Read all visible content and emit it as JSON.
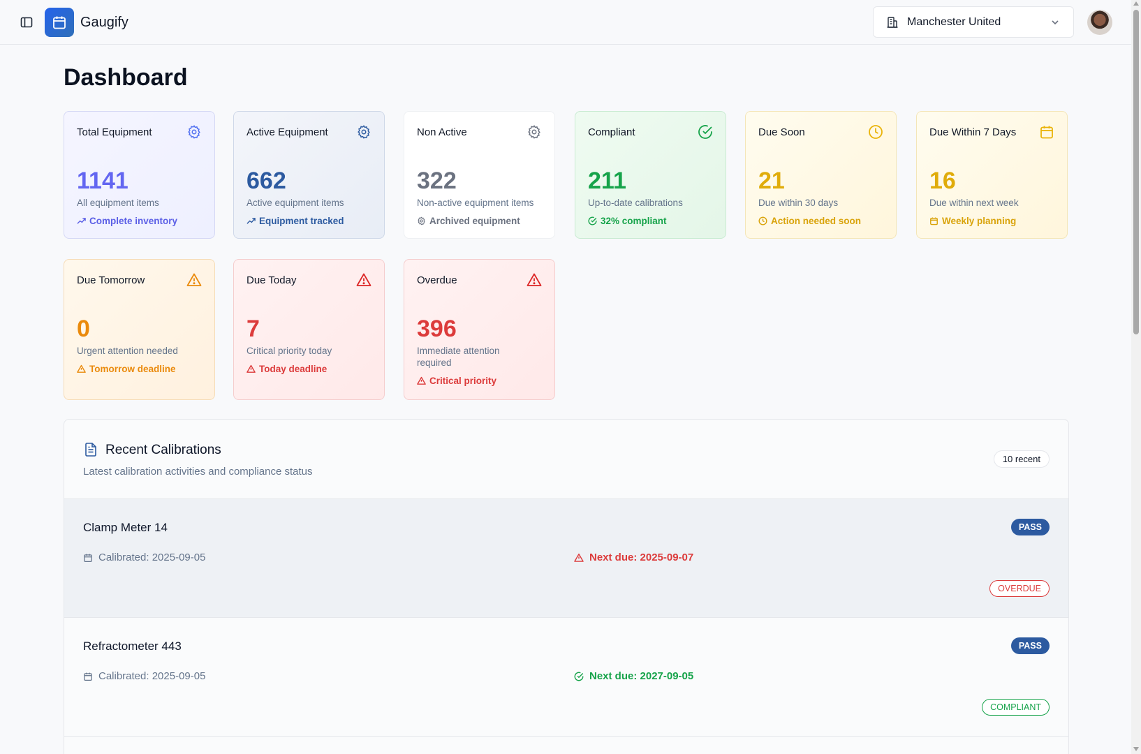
{
  "app": {
    "name": "Gaugify"
  },
  "header": {
    "org_name": "Manchester United"
  },
  "page": {
    "title": "Dashboard"
  },
  "colors": {
    "blue": "#6366f1",
    "navy": "#2c5aa0",
    "gray": "#6b7280",
    "green": "#16a34a",
    "yellow": "#eab308",
    "orange": "#ea8a0c",
    "red": "#dc2626"
  },
  "cards": [
    {
      "title": "Total Equipment",
      "value": "1141",
      "sub": "All equipment items",
      "foot": "Complete inventory",
      "icon": "gear-icon",
      "foot_icon": "trend-up-icon"
    },
    {
      "title": "Active Equipment",
      "value": "662",
      "sub": "Active equipment items",
      "foot": "Equipment tracked",
      "icon": "gear-icon",
      "foot_icon": "trend-up-icon"
    },
    {
      "title": "Non Active",
      "value": "322",
      "sub": "Non-active equipment items",
      "foot": "Archived equipment",
      "icon": "gear-icon",
      "foot_icon": "gear-icon"
    },
    {
      "title": "Compliant",
      "value": "211",
      "sub": "Up-to-date calibrations",
      "foot": "32% compliant",
      "icon": "check-circle-icon",
      "foot_icon": "check-circle-icon"
    },
    {
      "title": "Due Soon",
      "value": "21",
      "sub": "Due within 30 days",
      "foot": "Action needed soon",
      "icon": "clock-icon",
      "foot_icon": "clock-icon"
    },
    {
      "title": "Due Within 7 Days",
      "value": "16",
      "sub": "Due within next week",
      "foot": "Weekly planning",
      "icon": "calendar-icon",
      "foot_icon": "calendar-icon"
    },
    {
      "title": "Due Tomorrow",
      "value": "0",
      "sub": "Urgent attention needed",
      "foot": "Tomorrow deadline",
      "icon": "warning-icon",
      "foot_icon": "warning-icon"
    },
    {
      "title": "Due Today",
      "value": "7",
      "sub": "Critical priority today",
      "foot": "Today deadline",
      "icon": "warning-icon",
      "foot_icon": "warning-icon"
    },
    {
      "title": "Overdue",
      "value": "396",
      "sub": "Immediate attention required",
      "foot": "Critical priority",
      "icon": "warning-icon",
      "foot_icon": "warning-icon"
    }
  ],
  "recent": {
    "title": "Recent Calibrations",
    "subtitle": "Latest calibration activities and compliance status",
    "count": "10 recent",
    "rows": [
      {
        "name": "Clamp Meter 14",
        "result": "PASS",
        "calibrated": "Calibrated: 2025-09-05",
        "next_due": "Next due: 2025-09-07",
        "status": "OVERDUE"
      },
      {
        "name": "Refractometer 443",
        "result": "PASS",
        "calibrated": "Calibrated: 2025-09-05",
        "next_due": "Next due: 2027-09-05",
        "status": "COMPLIANT"
      }
    ]
  }
}
